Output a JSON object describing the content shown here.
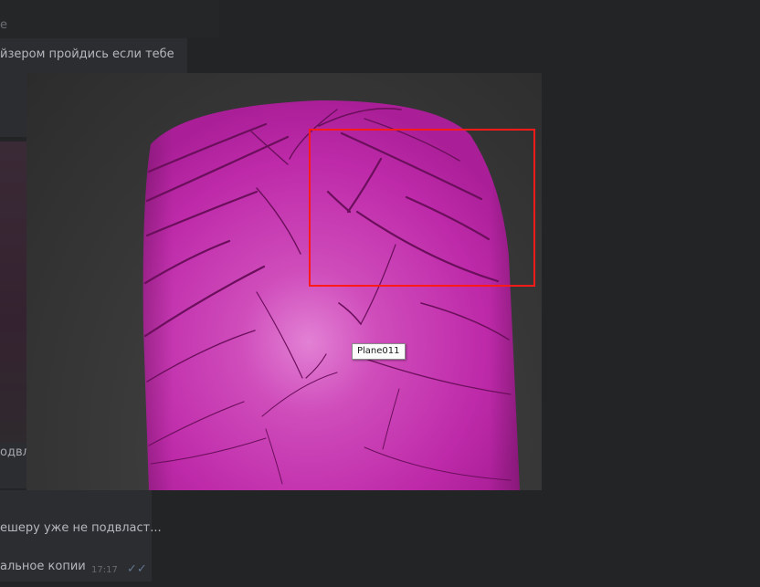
{
  "chat": {
    "header_text": "е",
    "message_top": "йзером пройдись если тебе",
    "left_caption": "одвл",
    "bottom_message_1": "ешеру уже не подвласт...",
    "bottom_message_2": "альное копии",
    "timestamp": "17:17"
  },
  "viewer": {
    "tooltip": "Plane011"
  },
  "colors": {
    "background": "#232426",
    "bubble": "#2b2d31",
    "tire": "#c22dac",
    "selection": "#ff1a1a"
  },
  "icons": {
    "read": "double-check-icon"
  }
}
